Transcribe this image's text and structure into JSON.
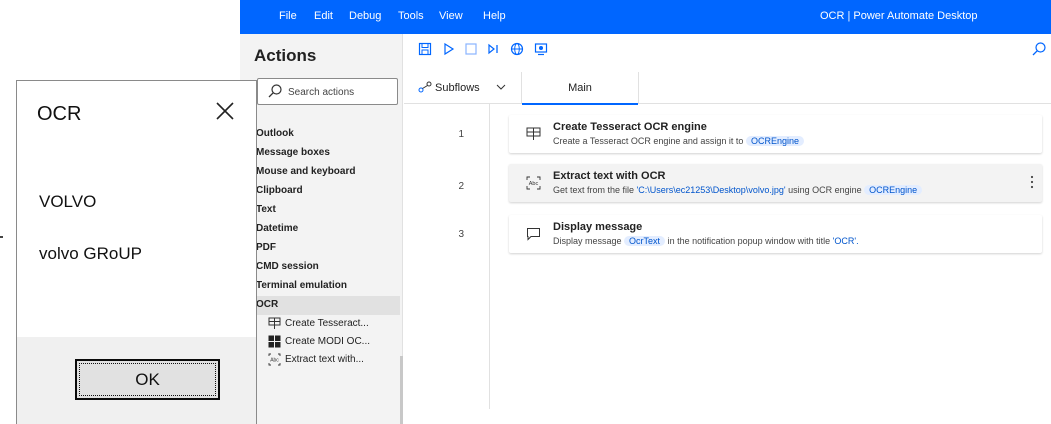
{
  "app": {
    "window_title": "OCR | Power Automate Desktop",
    "menu": [
      "File",
      "Edit",
      "Debug",
      "Tools",
      "View",
      "Help"
    ],
    "accent_color": "#0066ff"
  },
  "actions_panel": {
    "title": "Actions",
    "search_placeholder": "Search actions",
    "categories": [
      {
        "label": "Outlook",
        "expanded": false
      },
      {
        "label": "Message boxes",
        "expanded": false
      },
      {
        "label": "Mouse and keyboard",
        "expanded": false
      },
      {
        "label": "Clipboard",
        "expanded": false
      },
      {
        "label": "Text",
        "expanded": false
      },
      {
        "label": "Datetime",
        "expanded": false
      },
      {
        "label": "PDF",
        "expanded": false
      },
      {
        "label": "CMD session",
        "expanded": false
      },
      {
        "label": "Terminal emulation",
        "expanded": false
      },
      {
        "label": "OCR",
        "expanded": true
      }
    ],
    "ocr_items": [
      {
        "label": "Create Tesseract...",
        "icon": "tesseract-icon"
      },
      {
        "label": "Create MODI OC...",
        "icon": "windows-logo-icon"
      },
      {
        "label": "Extract text with...",
        "icon": "ocr-text-icon"
      }
    ]
  },
  "designer": {
    "toolbar_icons": [
      "save-icon",
      "run-icon",
      "stop-icon",
      "step-icon",
      "web-recorder-icon",
      "desktop-recorder-icon",
      "search-icon"
    ],
    "tabs": {
      "subflows": "Subflows",
      "main": "Main"
    },
    "steps": [
      {
        "number": "1",
        "title": "Create Tesseract OCR engine",
        "desc_prefix": "Create a Tesseract OCR engine and assign it to",
        "var": "OCREngine"
      },
      {
        "number": "2",
        "title": "Extract text with OCR",
        "desc_prefix": "Get text from the file",
        "file": "'C:\\Users\\ec21253\\Desktop\\volvo.jpg'",
        "desc_mid": "using OCR engine",
        "var": "OCREngine"
      },
      {
        "number": "3",
        "title": "Display message",
        "desc_prefix": "Display message",
        "var": "OcrText",
        "desc_mid": "in the notification popup window with title",
        "title_value": "'OCR'."
      }
    ]
  },
  "message_box": {
    "title": "OCR",
    "line1": "VOLVO",
    "line2": "volvo GRoUP",
    "ok_label": "OK"
  }
}
